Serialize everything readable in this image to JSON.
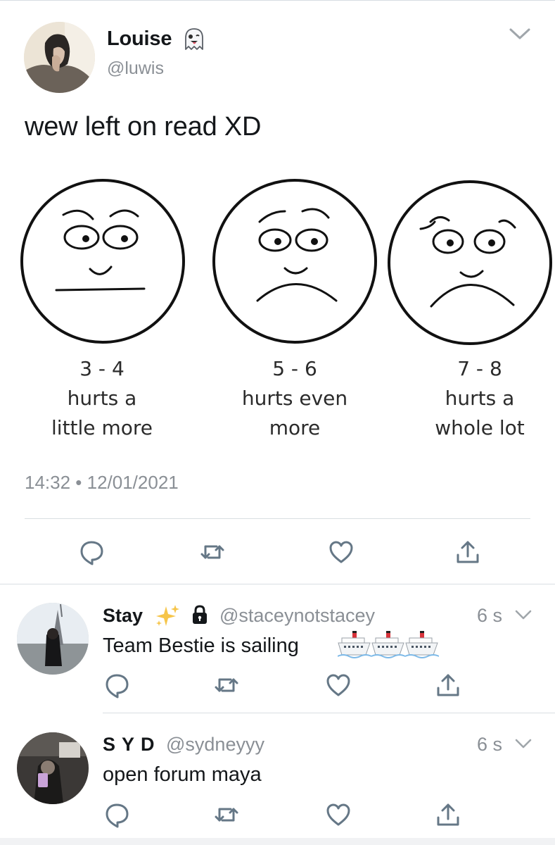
{
  "main_tweet": {
    "author_name": "Louise",
    "name_emoji": "ghost-emoji",
    "handle": "@luwis",
    "text": "wew left on read XD",
    "timestamp": "14:32 • 12/01/2021",
    "image_captions": [
      {
        "range": "3 - 4",
        "line1": "hurts a",
        "line2": "little more"
      },
      {
        "range": "5 - 6",
        "line1": "hurts even",
        "line2": "more"
      },
      {
        "range": "7 - 8",
        "line1": "hurts a",
        "line2": "whole lot"
      }
    ],
    "actions": [
      "reply-icon",
      "retweet-icon",
      "like-icon",
      "share-icon"
    ]
  },
  "replies": [
    {
      "author_name": "Stay",
      "badges": [
        "sparkles-emoji",
        "lock-icon"
      ],
      "handle": "@staceynotstacey",
      "time": "6 s",
      "text": "Team Bestie is sailing",
      "text_emojis": [
        "ship-emoji",
        "ship-emoji",
        "ship-emoji"
      ]
    },
    {
      "author_name": "S Y D",
      "handle": "@sydneyyy",
      "time": "6 s",
      "text": "open forum maya"
    }
  ],
  "colors": {
    "text": "#14171a",
    "secondary": "#8a8f95",
    "icon": "#657786",
    "divider": "#d9dee2",
    "sparkle": "#f6c54a"
  }
}
